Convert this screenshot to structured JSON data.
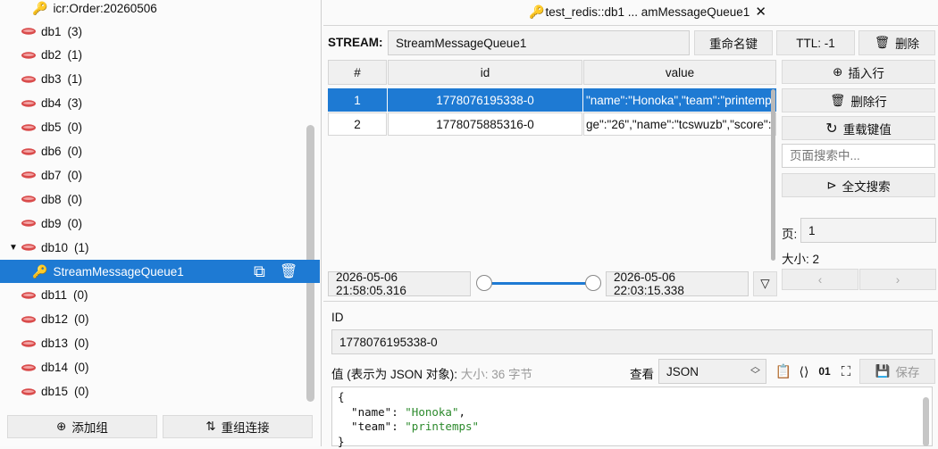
{
  "tree": {
    "top_key": "icr:Order:20260506",
    "dbs": [
      {
        "name": "db1",
        "count": "(3)"
      },
      {
        "name": "db2",
        "count": "(1)"
      },
      {
        "name": "db3",
        "count": "(1)"
      },
      {
        "name": "db4",
        "count": "(3)"
      },
      {
        "name": "db5",
        "count": "(0)"
      },
      {
        "name": "db6",
        "count": "(0)"
      },
      {
        "name": "db7",
        "count": "(0)"
      },
      {
        "name": "db8",
        "count": "(0)"
      },
      {
        "name": "db9",
        "count": "(0)"
      },
      {
        "name": "db10",
        "count": "(1)"
      },
      {
        "name": "db11",
        "count": "(0)"
      },
      {
        "name": "db12",
        "count": "(0)"
      },
      {
        "name": "db13",
        "count": "(0)"
      },
      {
        "name": "db14",
        "count": "(0)"
      },
      {
        "name": "db15",
        "count": "(0)"
      }
    ],
    "expanded_key": "StreamMessageQueue1",
    "add_group": "添加组",
    "reconnect": "重组连接"
  },
  "tab": {
    "title": "test_redis::db1 ... amMessageQueue1",
    "close": "✕"
  },
  "key_bar": {
    "type_label": "STREAM:",
    "key_name": "StreamMessageQueue1",
    "rename": "重命名键",
    "ttl": "TTL:  -1",
    "delete": "删除"
  },
  "table": {
    "headers": [
      "#",
      "id",
      "value"
    ],
    "rows": [
      {
        "n": "1",
        "id": "1778076195338-0",
        "value": "\"name\":\"Honoka\",\"team\":\"printemps"
      },
      {
        "n": "2",
        "id": "1778075885316-0",
        "value": "ge\":\"26\",\"name\":\"tcswuzb\",\"score\":\"3"
      }
    ]
  },
  "side_actions": {
    "insert": "插入行",
    "delete_row": "删除行",
    "reload": "重载键值",
    "search_placeholder": "页面搜索中...",
    "fulltext": "全文搜索",
    "page_label": "页:",
    "page_value": "1",
    "size_label": "大小:",
    "size_value": "2"
  },
  "range": {
    "start": "2026-05-06 21:58:05.316",
    "end": "2026-05-06 22:03:15.338"
  },
  "detail": {
    "id_label": "ID",
    "id_value": "1778076195338-0",
    "value_label": "值 (表示为 JSON 对象):",
    "size_hint": "大小: 36 字节",
    "view_label": "查看",
    "view_value": "JSON",
    "save": "保存",
    "json_lines": [
      {
        "t": "{"
      },
      {
        "k": "\"name\"",
        "v": "\"Honoka\"",
        "comma": ","
      },
      {
        "k": "\"team\"",
        "v": "\"printemps\"",
        "comma": ""
      },
      {
        "t": "}"
      }
    ]
  }
}
